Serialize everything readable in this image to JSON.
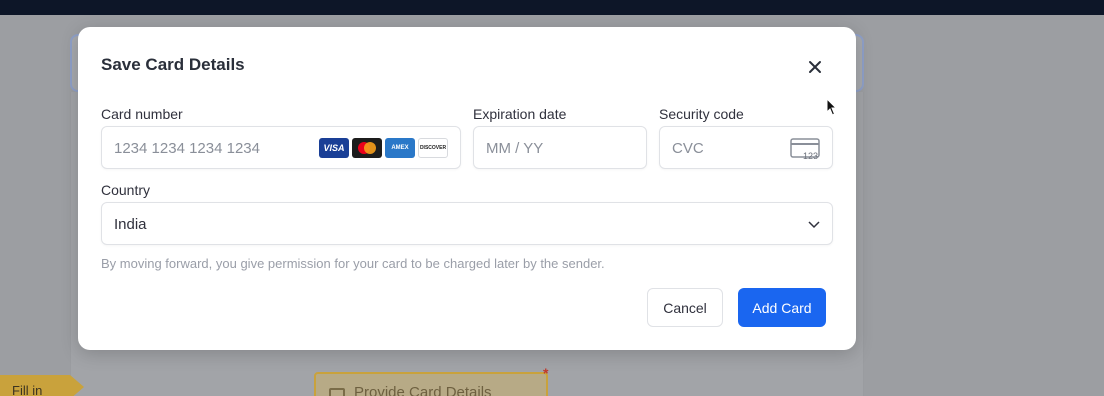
{
  "background": {
    "fill_tag": "Fill in",
    "provide_button": "Provide Card Details"
  },
  "modal": {
    "title": "Save Card Details",
    "card_number": {
      "label": "Card number",
      "placeholder": "1234 1234 1234 1234",
      "brands": [
        "VISA",
        "mastercard",
        "AMERICAN EXPRESS",
        "DISCOVER"
      ]
    },
    "expiration": {
      "label": "Expiration date",
      "placeholder": "MM / YY"
    },
    "security": {
      "label": "Security code",
      "placeholder": "CVC",
      "icon_text": "123"
    },
    "country": {
      "label": "Country",
      "value": "India"
    },
    "note": "By moving forward, you give permission for your card to be charged later by the sender.",
    "cancel_label": "Cancel",
    "add_label": "Add Card"
  },
  "colors": {
    "primary": "#1a66f0",
    "overlay": "#9c9ea2",
    "accent_gold": "#c9a23c"
  }
}
